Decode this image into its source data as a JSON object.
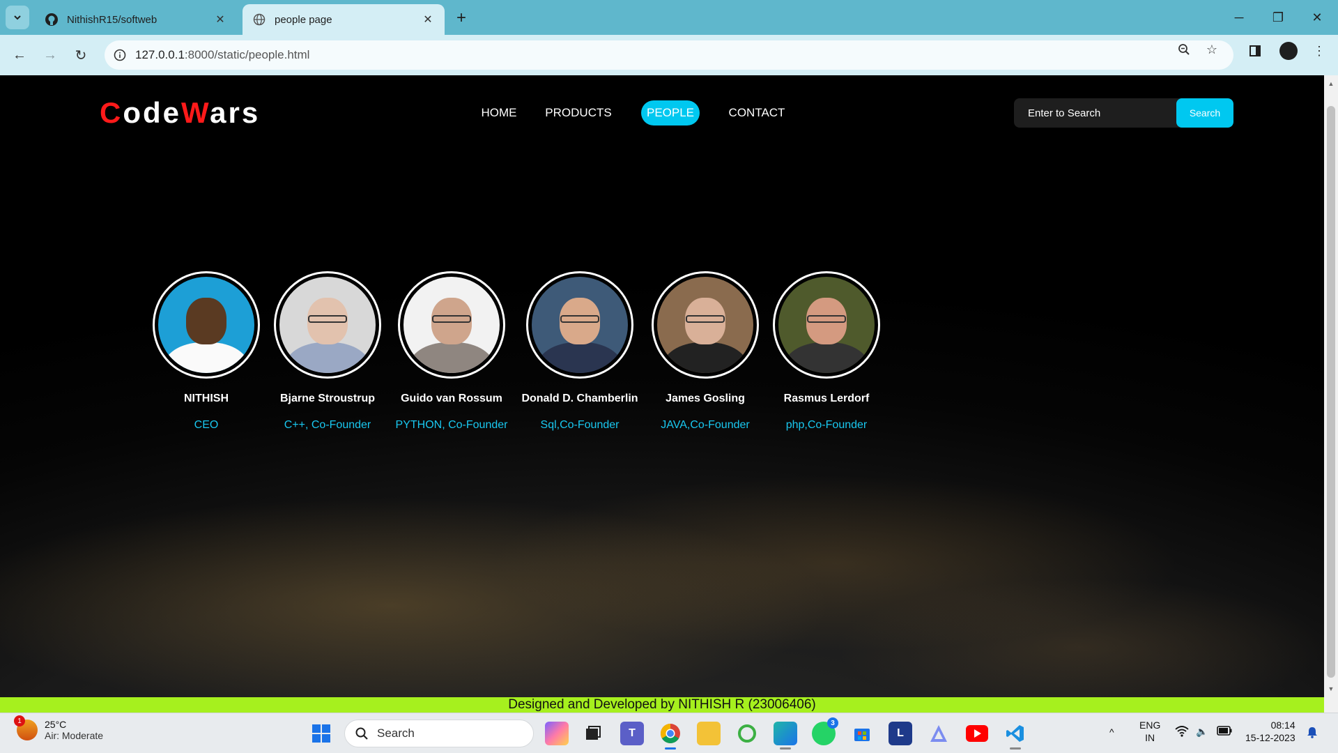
{
  "browser": {
    "tabs": [
      {
        "title": "NithishR15/softweb",
        "icon": "github-icon"
      },
      {
        "title": "people page",
        "icon": "globe-icon"
      }
    ],
    "url_host": "127.0.0.1",
    "url_path": ":8000/static/people.html"
  },
  "site": {
    "logo_parts": [
      "C",
      "ode",
      "W",
      "ars"
    ],
    "nav": [
      "HOME",
      "PRODUCTS",
      "PEOPLE",
      "CONTACT"
    ],
    "active_nav": "PEOPLE",
    "search_placeholder": "Enter to Search",
    "search_button": "Search",
    "colors": {
      "accent": "#00c8f0",
      "logo_red": "#ff1a1a",
      "footer": "#a6f01e"
    }
  },
  "people": [
    {
      "name": "NITHISH",
      "role": "CEO"
    },
    {
      "name": "Bjarne Stroustrup",
      "role": "C++, Co-Founder"
    },
    {
      "name": "Guido van Rossum",
      "role": "PYTHON, Co-Founder"
    },
    {
      "name": "Donald D. Chamberlin",
      "role": "Sql,Co-Founder"
    },
    {
      "name": "James Gosling",
      "role": "JAVA,Co-Founder"
    },
    {
      "name": "Rasmus Lerdorf",
      "role": "php,Co-Founder"
    }
  ],
  "footer": "Designed and Developed by NITHISH R (23006406)",
  "taskbar": {
    "weather_temp": "25°C",
    "weather_desc": "Air: Moderate",
    "weather_badge": "1",
    "search": "Search",
    "whatsapp_badge": "3",
    "lang_1": "ENG",
    "lang_2": "IN",
    "time": "08:14",
    "date": "15-12-2023"
  }
}
